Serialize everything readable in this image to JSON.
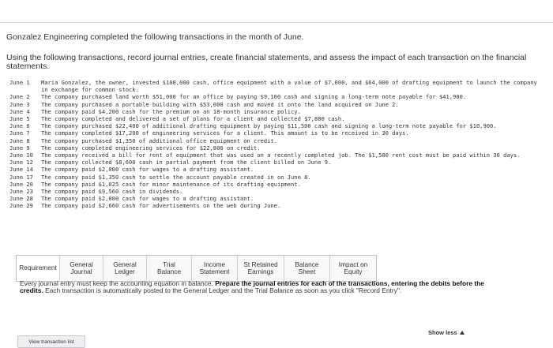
{
  "header": {
    "title": "Gonzalez Engineering completed the following transactions in the month of June.",
    "intro": "Using the following transactions, record journal entries, create financial statements, and assess the impact of each transaction on the financial statements."
  },
  "transactions": [
    {
      "date": "June 1",
      "text": "Maria Gonzalez, the owner, invested $108,000 cash, office equipment with a value of $7,000, and $64,000 of drafting equipment to launch the company in exchange for common stock."
    },
    {
      "date": "June 2",
      "text": "The company purchased land worth $51,000 for an office by paying $9,100 cash and signing a long-term note payable for $41,900."
    },
    {
      "date": "June 3",
      "text": "The company purchased a portable building with $53,000 cash and moved it onto the land acquired on June 2."
    },
    {
      "date": "June 4",
      "text": "The company paid $4,200 cash for the premium on an 18-month insurance policy."
    },
    {
      "date": "June 5",
      "text": "The company completed and delivered a set of plans for a client and collected $7,800 cash."
    },
    {
      "date": "June 6",
      "text": "The company purchased $22,400 of additional drafting equipment by paying $11,500 cash and signing a long-term note payable for $10,900."
    },
    {
      "date": "June 7",
      "text": "The company completed $17,200 of engineering services for a client. This amount is to be received in 30 days."
    },
    {
      "date": "June 8",
      "text": "The company purchased $1,350 of additional office equipment on credit."
    },
    {
      "date": "June 9",
      "text": "The company completed engineering services for $22,800 on credit."
    },
    {
      "date": "June 10",
      "text": "The company received a bill for rent of equipment that was used on a recently completed job. The $1,500 rent cost must be paid within 30 days."
    },
    {
      "date": "June 12",
      "text": "The company collected $8,600 cash in partial payment from the client billed on June 9."
    },
    {
      "date": "June 14",
      "text": "The company paid $2,000 cash for wages to a drafting assistant."
    },
    {
      "date": "June 17",
      "text": "The company paid $1,350 cash to settle the account payable created in on June 8."
    },
    {
      "date": "June 20",
      "text": "The company paid $1,025 cash for minor maintenance of its drafting equipment."
    },
    {
      "date": "June 23",
      "text": "The company paid $9,560 cash in dividends."
    },
    {
      "date": "June 28",
      "text": "The company paid $2,000 cash for wages to a drafting assistant."
    },
    {
      "date": "June 29",
      "text": "The company paid $2,660 cash for advertisements on the web during June."
    }
  ],
  "tabs": [
    {
      "label": "Requirement",
      "name": "tab-requirement",
      "width": 55
    },
    {
      "label": "General Journal",
      "name": "tab-general-journal",
      "width": 55
    },
    {
      "label": "General Ledger",
      "name": "tab-general-ledger",
      "width": 55
    },
    {
      "label": "Trial Balance",
      "name": "tab-trial-balance",
      "width": 57
    },
    {
      "label": "Income Statement",
      "name": "tab-income-statement",
      "width": 58
    },
    {
      "label": "St Retained Earnings",
      "name": "tab-st-retained-earnings",
      "width": 59
    },
    {
      "label": "Balance Sheet",
      "name": "tab-balance-sheet",
      "width": 58
    },
    {
      "label": "Impact on Equity",
      "name": "tab-impact-on-equity",
      "width": 58
    }
  ],
  "instructions": {
    "part1": "Every journal entry must keep the accounting equation in balance. ",
    "bold": "Prepare the journal entries for each of the transactions, entering the debits before the credits.",
    "part2": " Each transaction is automatically posted to the General Ledger and the Trial Balance as soon as you click \"Record Entry\"."
  },
  "show_less_label": "Show less",
  "view_list_label": "View transaction list"
}
